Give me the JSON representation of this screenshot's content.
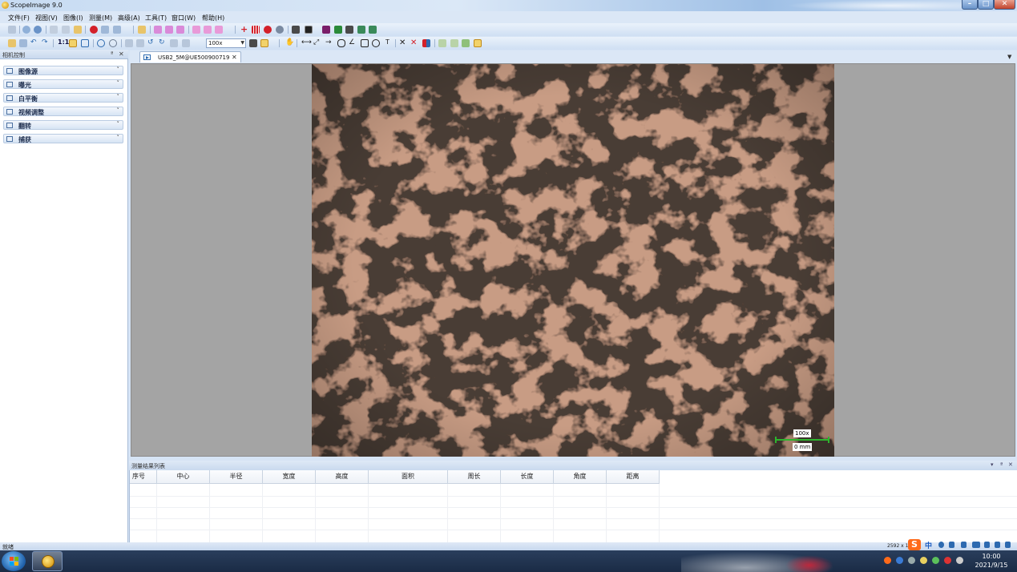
{
  "window": {
    "title": "ScopeImage 9.0",
    "minimize": "–",
    "maximize": "□",
    "close": "✕"
  },
  "menu": [
    "文件(F)",
    "视图(V)",
    "图像(I)",
    "测量(M)",
    "高级(A)",
    "工具(T)",
    "窗口(W)",
    "帮助(H)"
  ],
  "toolbar": {
    "ratio_label": "1:1",
    "zoom_value": "100x",
    "text_tool": "T"
  },
  "left_panel": {
    "title": "相机控制",
    "pin": "ª",
    "close": "✕",
    "sections": [
      {
        "label": "图像源",
        "icon": "image-source-icon"
      },
      {
        "label": "曝光",
        "icon": "exposure-icon"
      },
      {
        "label": "白平衡",
        "icon": "white-balance-icon"
      },
      {
        "label": "视频调整",
        "icon": "video-adjust-icon"
      },
      {
        "label": "翻转",
        "icon": "flip-icon"
      },
      {
        "label": "捕获",
        "icon": "capture-icon"
      }
    ],
    "chevron": "˅"
  },
  "document_tab": {
    "label": "USB2_5M@UE500900719",
    "close": "✕"
  },
  "image": {
    "magnification": "100x",
    "scale": "0 mm",
    "scale_color": "#2db52d"
  },
  "results": {
    "title": "测量结果列表",
    "controls": [
      "▾",
      "ª",
      "✕"
    ],
    "columns": [
      "序号",
      "中心",
      "半径",
      "宽度",
      "高度",
      "面积",
      "周长",
      "长度",
      "角度",
      "距离"
    ]
  },
  "status": {
    "text": "就绪",
    "resolution": "2592 x 1"
  },
  "ime": {
    "logo": "S",
    "mode": "中"
  },
  "clock": {
    "time": "10:00",
    "date": "2021/9/15"
  },
  "colors": {
    "accent": "#2d6ab0",
    "taskbar": "#1a2b45",
    "panel": "#dbe7f6"
  }
}
